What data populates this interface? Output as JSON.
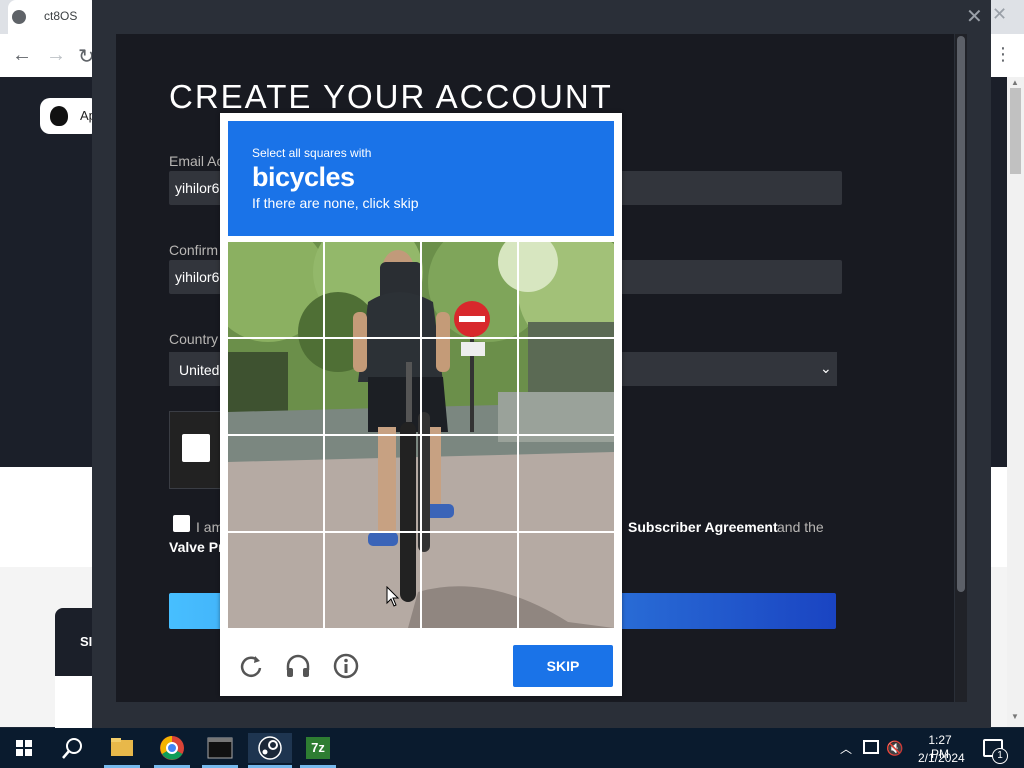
{
  "browser": {
    "tab_title": "ct8OS",
    "back_glyph": "←",
    "forward_glyph": "→",
    "reload_glyph": "↻",
    "menu_glyph": "⋮"
  },
  "background_page": {
    "apple_button_label": "Ap",
    "dark_card_text": "SI"
  },
  "modal": {
    "close_glyph": "✕",
    "title": "CREATE YOUR ACCOUNT",
    "email": {
      "label": "Email Ac",
      "value": "yihilor6"
    },
    "confirm": {
      "label": "Confirm",
      "value": "yihilor6"
    },
    "country": {
      "label": "Country",
      "value": "United",
      "chevron": "⌄"
    },
    "agreement": {
      "prefix": "I am",
      "link": "Subscriber Agreement",
      "tail": "and the",
      "privacy_link": "Valve Pr"
    }
  },
  "captcha": {
    "instruction": "Select all squares with",
    "object": "bicycles",
    "hint": "If there are none, click skip",
    "skip_label": "SKIP",
    "icons": [
      "reload-icon",
      "headphones-icon",
      "info-icon"
    ]
  },
  "taskbar": {
    "apps": [
      "windows-start",
      "search",
      "file-explorer",
      "chrome",
      "terminal",
      "steam",
      "7zip"
    ],
    "sevenzip_label": "7z",
    "clock_time": "1:27 PM",
    "clock_date": "2/1/2024",
    "notification_count": "1"
  }
}
